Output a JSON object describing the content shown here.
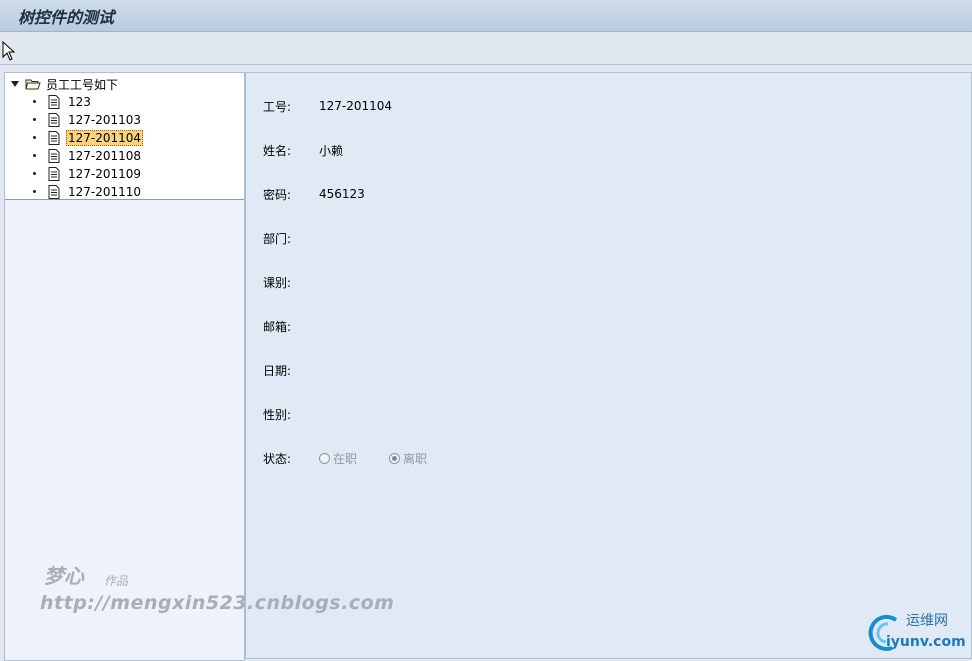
{
  "window": {
    "title": "树控件的测试"
  },
  "tree": {
    "root_label": "员工工号如下",
    "items": [
      {
        "label": "123"
      },
      {
        "label": "127-201103"
      },
      {
        "label": "127-201104"
      },
      {
        "label": "127-201108"
      },
      {
        "label": "127-201109"
      },
      {
        "label": "127-201110"
      }
    ],
    "selected": "127-201104"
  },
  "form": {
    "job_no": {
      "label": "工号:",
      "value": "127-201104"
    },
    "name": {
      "label": "姓名:",
      "value": "小赖"
    },
    "password": {
      "label": "密码:",
      "value": "456123"
    },
    "department": {
      "label": "部门:",
      "value": ""
    },
    "section": {
      "label": "课别:",
      "value": ""
    },
    "email": {
      "label": "邮箱:",
      "value": ""
    },
    "date": {
      "label": "日期:",
      "value": ""
    },
    "gender": {
      "label": "性别:",
      "value": ""
    },
    "status": {
      "label": "状态:",
      "options": [
        {
          "label": "在职",
          "checked": false
        },
        {
          "label": "离职",
          "checked": true
        }
      ]
    }
  },
  "watermark": {
    "signature": "梦心",
    "sub": "作品",
    "url": "http://mengxin523.cnblogs.com"
  },
  "logo": {
    "name": "运维网",
    "domain": "iyunv.com"
  },
  "colors": {
    "selection": "#fbd37a",
    "pane_bg": "#e0eaf5",
    "title_text": "#1d2f45"
  }
}
